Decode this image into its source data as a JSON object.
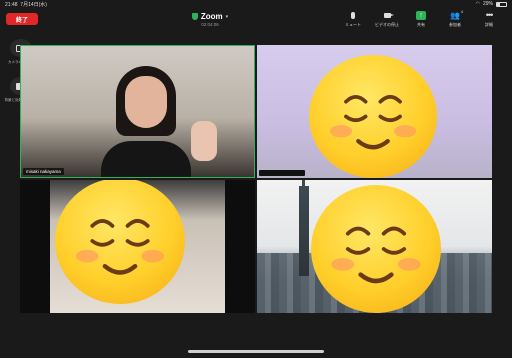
{
  "status_bar": {
    "time": "21:48",
    "date": "7月14日(水)",
    "battery": "29%"
  },
  "end_button": {
    "label": "終了"
  },
  "meeting": {
    "title": "Zoom",
    "timer": "02:04:06"
  },
  "toolbar": {
    "mute": "ミュート",
    "stop_video": "ビデオの停止",
    "share": "共有",
    "participants": "参加者",
    "participants_count": "4",
    "more": "詳細"
  },
  "side": {
    "camera_switch": "カメラの切り替え",
    "background": "背景と効果の切り替え"
  },
  "participants": [
    {
      "name": "misaki nakayama",
      "active_speaker": true
    },
    {
      "name": ""
    },
    {
      "name": ""
    },
    {
      "name": ""
    }
  ],
  "colors": {
    "active_border": "#2db45a",
    "end_button": "#e02828",
    "share_button": "#2db45a"
  }
}
